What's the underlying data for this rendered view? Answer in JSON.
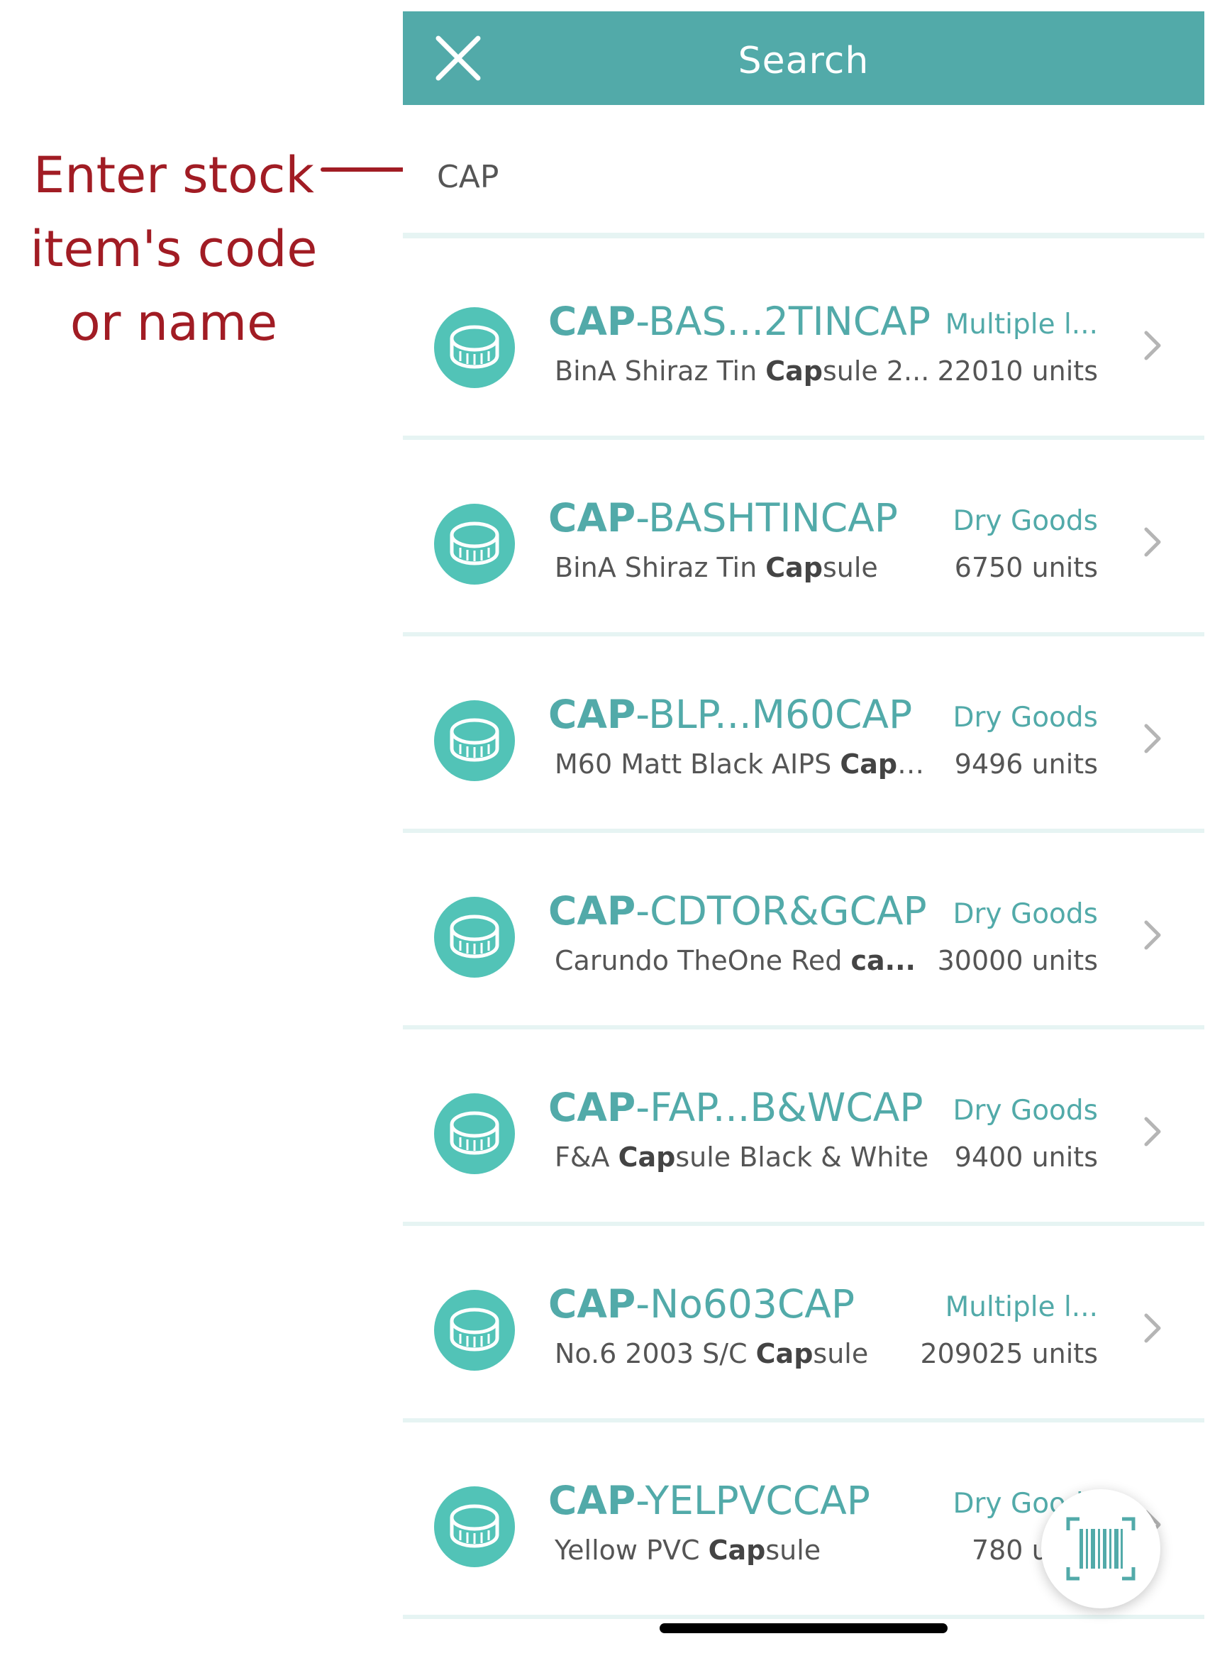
{
  "annotation": {
    "text": "Enter stock\nitem's code\nor name"
  },
  "header": {
    "title": "Search",
    "close_icon": "close-icon"
  },
  "search": {
    "value": "CAP"
  },
  "colors": {
    "teal": "#52aaa9",
    "icon_bg": "#52c3b7",
    "annotation": "#a11c24"
  },
  "results": [
    {
      "code_match": "CAP",
      "code_rest": "-BAS...2TINCAP",
      "category": "Multiple l...",
      "desc_pre": "BinA Shiraz Tin ",
      "desc_match": "Cap",
      "desc_post": "sule 2...",
      "units": "22010 units"
    },
    {
      "code_match": "CAP",
      "code_rest": "-BASHTINCAP",
      "category": "Dry Goods",
      "desc_pre": "BinA Shiraz Tin ",
      "desc_match": "Cap",
      "desc_post": "sule",
      "units": "6750 units"
    },
    {
      "code_match": "CAP",
      "code_rest": "-BLP...M60CAP",
      "category": "Dry Goods",
      "desc_pre": "M60 Matt Black AIPS ",
      "desc_match": "Caps",
      "desc_post": "...",
      "units": "9496 units"
    },
    {
      "code_match": "CAP",
      "code_rest": "-CDTOR&GCAP",
      "category": "Dry Goods",
      "desc_pre": "Carundo TheOne Red ",
      "desc_match": "ca...",
      "desc_post": "",
      "units": "30000 units"
    },
    {
      "code_match": "CAP",
      "code_rest": "-FAP...B&WCAP",
      "category": "Dry Goods",
      "desc_pre": "F&A ",
      "desc_match": "Cap",
      "desc_post": "sule Black & White",
      "units": "9400 units"
    },
    {
      "code_match": "CAP",
      "code_rest": "-No603CAP",
      "category": "Multiple l...",
      "desc_pre": "No.6 2003 S/C ",
      "desc_match": "Cap",
      "desc_post": "sule",
      "units": "209025 units"
    },
    {
      "code_match": "CAP",
      "code_rest": "-YELPVCCAP",
      "category": "Dry Goods",
      "desc_pre": "Yellow PVC ",
      "desc_match": "Cap",
      "desc_post": "sule",
      "units": "780 units"
    }
  ],
  "fab": {
    "icon": "barcode-scan-icon"
  }
}
